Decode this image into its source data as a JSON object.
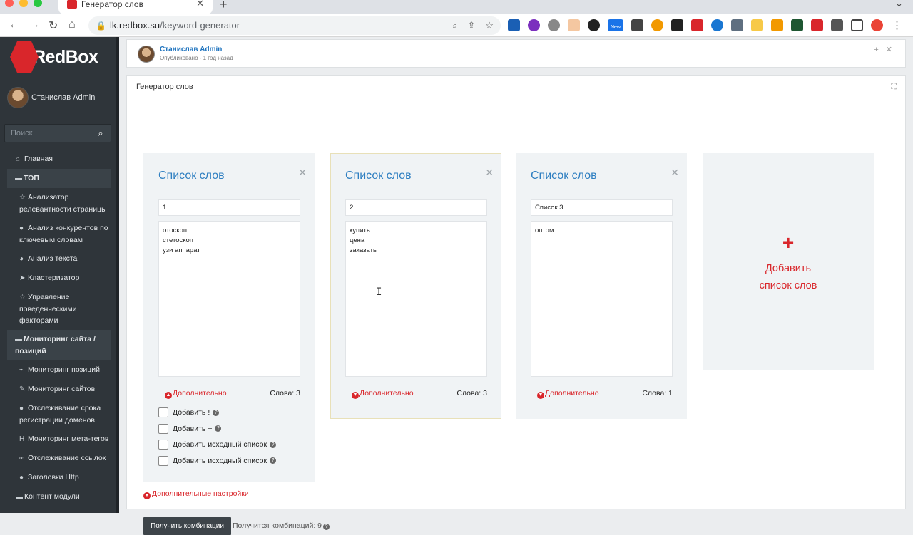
{
  "browser": {
    "tab_title": "Генератор слов",
    "url_host": "lk.redbox.su",
    "url_path": "/keyword-generator",
    "new_badge": "New"
  },
  "sidebar": {
    "logo": "RedBox",
    "user_name": "Станислав Admin",
    "search_placeholder": "Поиск",
    "items": [
      {
        "label": "Главная",
        "icon": "home-icon"
      },
      {
        "label": "ТОП",
        "icon": "folder-icon"
      },
      {
        "label": "Анализатор релевантности страницы",
        "icon": "star-icon"
      },
      {
        "label": "Анализ конкурентов по ключевым словам",
        "icon": "globe-icon"
      },
      {
        "label": "Анализ текста",
        "icon": "pie-icon"
      },
      {
        "label": "Кластеризатор",
        "icon": "send-icon"
      },
      {
        "label": "Управление поведенческими факторами",
        "icon": "star-icon"
      },
      {
        "label": "Мониторинг сайта / позиций",
        "icon": "folder-icon"
      },
      {
        "label": "Мониторинг позиций",
        "icon": "chart-icon"
      },
      {
        "label": "Мониторинг сайтов",
        "icon": "edit-icon"
      },
      {
        "label": "Отслеживание срока регистрации доменов",
        "icon": "globe-icon"
      },
      {
        "label": "Мониторинг мета-тегов",
        "icon": "heading-icon"
      },
      {
        "label": "Отслеживание ссылок",
        "icon": "link-icon"
      },
      {
        "label": "Заголовки Http",
        "icon": "globe-icon"
      },
      {
        "label": "Контент модули",
        "icon": "folder-icon"
      }
    ]
  },
  "post": {
    "author": "Станислав Admin",
    "meta": "Опубликовано - 1 год назад"
  },
  "card": {
    "title": "Генератор слов"
  },
  "panels": [
    {
      "title": "Список слов",
      "name": "1",
      "words": [
        "отоскоп",
        "стетоскоп",
        "узи аппарат"
      ],
      "more": "Дополнительно",
      "count": "Слова: 3"
    },
    {
      "title": "Список слов",
      "name": "2",
      "words": [
        "купить",
        "цена",
        "заказать"
      ],
      "more": "Дополнительно",
      "count": "Слова: 3"
    },
    {
      "title": "Список слов",
      "name": "Список 3",
      "words": [
        "оптом"
      ],
      "more": "Дополнительно",
      "count": "Слова: 1"
    }
  ],
  "options": [
    {
      "label": "Добавить !"
    },
    {
      "label": "Добавить +"
    },
    {
      "label": "Добавить исходный список"
    },
    {
      "label": "Добавить исходный список"
    }
  ],
  "add_panel": {
    "line1": "Добавить",
    "line2": "список слов"
  },
  "more_settings": "Дополнительные настройки",
  "get_button": "Получить комбинации",
  "combos_text": "Получится комбинаций: 9",
  "colors": {
    "accent": "#d9262b",
    "link": "#2f7fc1",
    "sidebar": "#2f353a"
  }
}
